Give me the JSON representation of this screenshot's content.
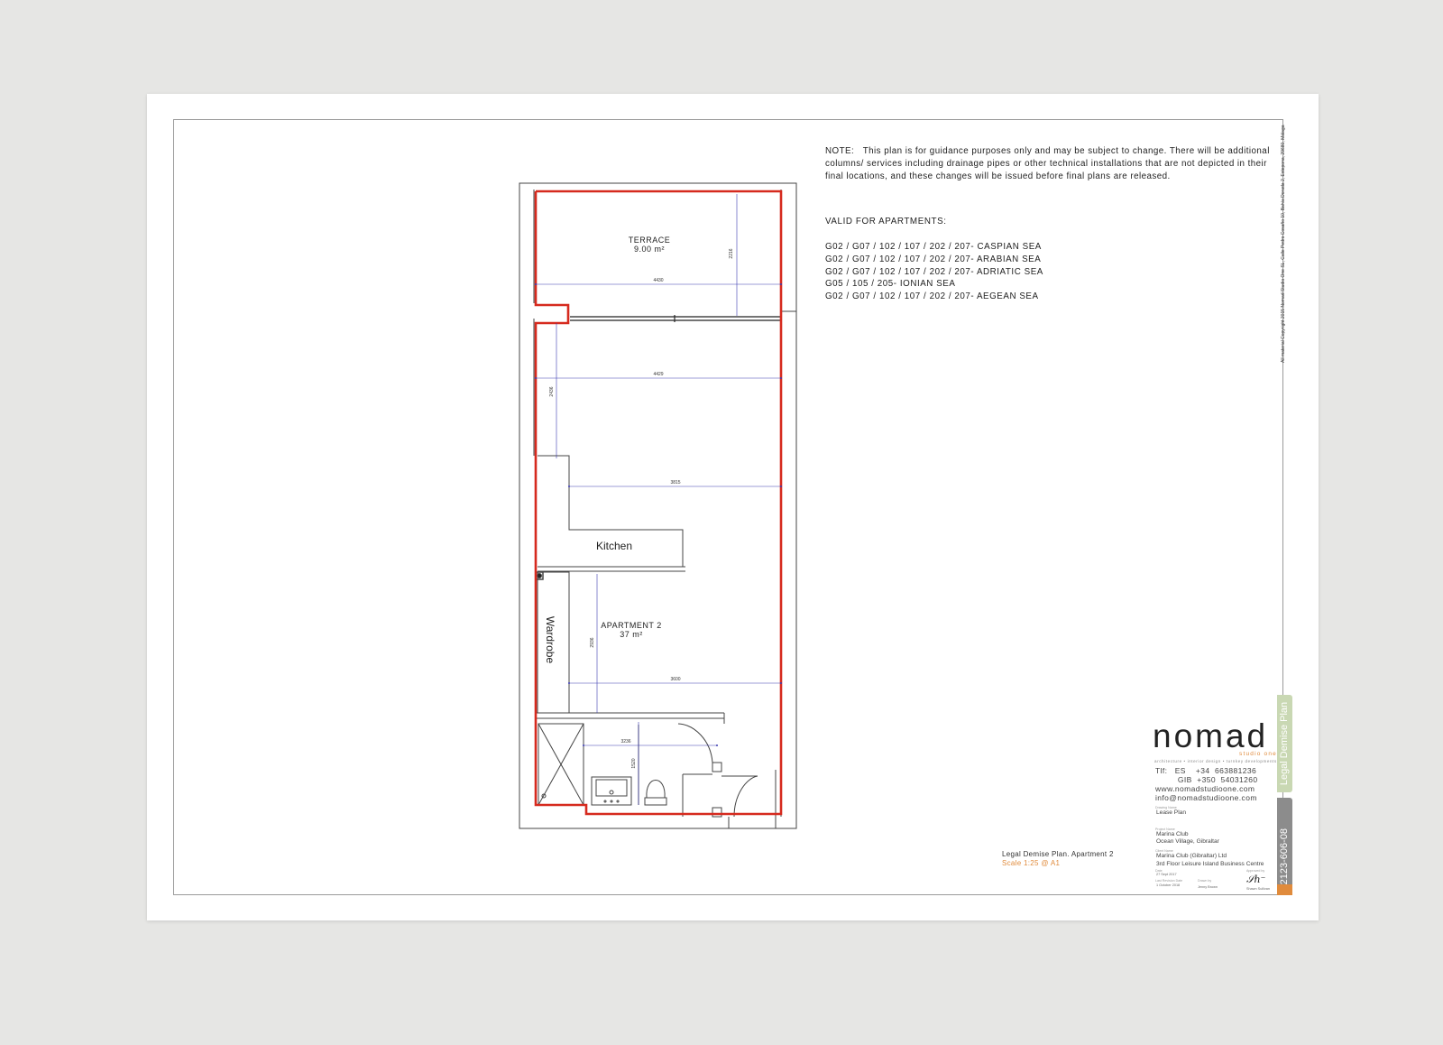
{
  "note": {
    "label": "NOTE:",
    "text": "This plan is for guidance purposes only and may be subject to change. There will be additional columns/ services including drainage pipes or other technical installations that are not depicted in their final locations, and these changes will be issued before final plans are released."
  },
  "valid_title": "VALID FOR APARTMENTS:",
  "apartments": [
    "G02 / G07 / 102 / 107 / 202 / 207- CASPIAN SEA",
    "G02 / G07 / 102 / 107 / 202 / 207- ARABIAN SEA",
    "G02 / G07 / 102 / 107 / 202 / 207- ADRIATIC SEA",
    "G05 / 105 / 205-  IONIAN SEA",
    "G02 / G07 / 102 / 107 / 202 / 207- AEGEAN SEA"
  ],
  "plan": {
    "terrace_name": "TERRACE",
    "terrace_area": "9.00 m²",
    "kitchen": "Kitchen",
    "wardrobe": "Wardrobe",
    "apartment_name": "APARTMENT 2",
    "apartment_area": "37 m²",
    "dims": {
      "terrace_width": "4430",
      "terrace_depth": "2216",
      "living_width": "4429",
      "living_depth": "2436",
      "mid_width": "3815",
      "bed_width": "3600",
      "bed_depth": "2936",
      "bath_width": "3236",
      "bath_depth": "1520"
    },
    "colors": {
      "demise_line": "#d62a1e",
      "dimension_line": "#3a3ab0",
      "wall": "#444444"
    }
  },
  "copyright": "All material Copyright 2015 Nomad Studio One SL, Calle Pedro Cosaño 10, Bahía Dorada 2, Estepona, 29680, Málaga",
  "side_tabs": {
    "plan_type": "Legal Demise Plan",
    "drawing_number": "-2123-606-08"
  },
  "logo": {
    "name": "nomad",
    "sub": "studio one",
    "tagline": "architecture • interior design • turnkey developments"
  },
  "contact": {
    "tel_es": "Tlf:   ES    +34  663881236",
    "tel_gib": "         GIB  +350  54031260",
    "web": "www.nomadstudioone.com",
    "email": "info@nomadstudioone.com"
  },
  "title_block": {
    "drawing_name_label": "Drawing Name",
    "drawing_name": "Lease Plan",
    "project_name_label": "Project Name",
    "project_name_1": "Marina Club",
    "project_name_2": "Ocean Village, Gibraltar",
    "client_label": "Client Name",
    "client_1": "Marina Club (Gibraltar) Ltd",
    "client_2": "3rd Floor Leisure Island Business Centre",
    "date_label": "Date",
    "date": "27 Sept 2017",
    "revision_label": "Last Revision Date",
    "revision": "1 October 2018",
    "drawn_label": "Drawn by",
    "drawn": "Jenny Brown",
    "approved_label": "Approved by",
    "approved": "Shawn Sullivan"
  },
  "caption": {
    "title": "Legal Demise Plan. Apartment 2",
    "scale": "Scale 1:25 @ A1"
  }
}
